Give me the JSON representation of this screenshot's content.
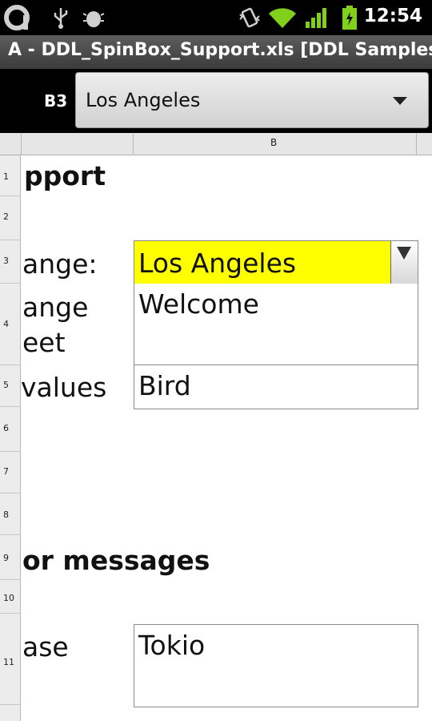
{
  "status_bar": {
    "time": "12:54",
    "icons": [
      "app-logo-icon",
      "usb-icon",
      "android-debug-icon",
      "vibrate-icon",
      "wifi-icon",
      "signal-icon",
      "battery-icon"
    ]
  },
  "window": {
    "title": "A - DDL_SpinBox_Support.xls [DDL Samples]"
  },
  "toolbar": {
    "cell_ref": "B3",
    "combo_value": "Los Angeles"
  },
  "sheet": {
    "column_b": "B",
    "rows": [
      "1",
      "2",
      "3",
      "4",
      "5",
      "6",
      "7",
      "8",
      "9",
      "10",
      "11"
    ],
    "labels": {
      "r1": "pport",
      "r3": "ange:",
      "r4a": "ange",
      "r4b": "eet",
      "r5": " values",
      "r9": "or messages",
      "r11": "ase"
    },
    "cells": {
      "b3": "Los Angeles",
      "b4": "Welcome",
      "b5": "Bird",
      "b11": "Tokio"
    }
  },
  "colors": {
    "highlight": "#ffff00",
    "status_bg": "#000000",
    "wifi_green": "#80d01c"
  }
}
